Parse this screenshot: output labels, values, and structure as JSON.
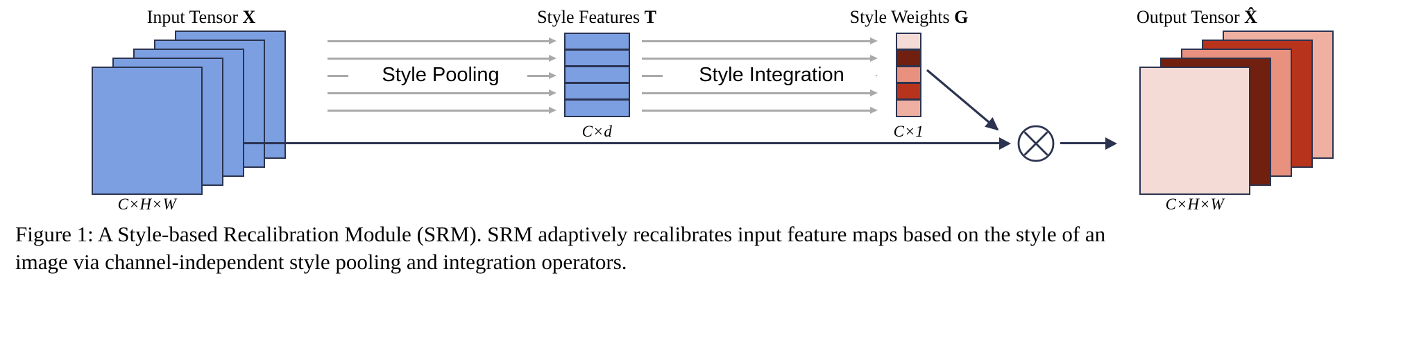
{
  "figure": {
    "labels": {
      "input_tensor": "Input Tensor",
      "input_tensor_sym": "X",
      "input_dims": "C×H×W",
      "style_features": "Style Features",
      "style_features_sym": "T",
      "style_features_dims": "C×d",
      "style_weights": "Style Weights",
      "style_weights_sym": "G",
      "style_weights_dims": "C×1",
      "output_tensor": "Output Tensor",
      "output_tensor_sym": "X̂",
      "output_dims": "C×H×W"
    },
    "operations": {
      "style_pooling": "Style Pooling",
      "style_integration": "Style Integration",
      "multiply_symbol": "⊗"
    },
    "colors": {
      "tensor_blue": "#7B9FE0",
      "outline_navy": "#2b3350",
      "arrow_gray": "#a9a9a9",
      "weight_light_pink": "#F4DBD6",
      "weight_dark_maroon": "#71200F",
      "weight_salmon": "#E8917F",
      "weight_brick_red": "#B8331C",
      "weight_pale_salmon": "#EFB0A1",
      "background": "#ffffff"
    },
    "input_stack_colors": [
      "#7B9FE0",
      "#7B9FE0",
      "#7B9FE0",
      "#7B9FE0",
      "#7B9FE0"
    ],
    "style_feature_rows": 5,
    "style_weight_values": [
      "#F4DBD6",
      "#71200F",
      "#E8917F",
      "#B8331C",
      "#EFB0A1"
    ],
    "output_stack_colors": [
      "#F4DBD6",
      "#71200F",
      "#E8917F",
      "#B8331C",
      "#EFB0A1"
    ],
    "pooling_arrow_count": 5,
    "integration_arrow_count": 5
  },
  "caption": {
    "line1": "Figure 1: A Style-based Recalibration Module (SRM). SRM adaptively recalibrates input feature maps based on the style of an",
    "line2": "image via channel-independent style pooling and integration operators."
  }
}
